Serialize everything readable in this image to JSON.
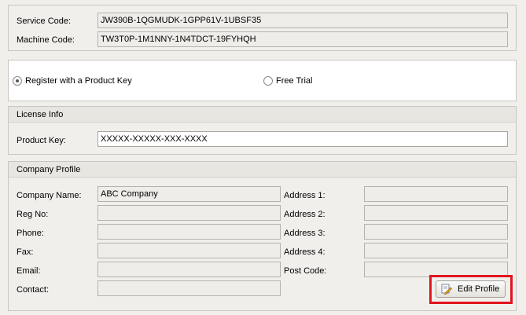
{
  "codes": {
    "service_label": "Service Code:",
    "service_value": "JW390B-1QGMUDK-1GPP61V-1UBSF35",
    "machine_label": "Machine Code:",
    "machine_value": "TW3T0P-1M1NNY-1N4TDCT-19FYHQH"
  },
  "registration": {
    "option_product_key": "Register with a Product Key",
    "option_free_trial": "Free Trial",
    "selected": "product_key"
  },
  "license": {
    "title": "License Info",
    "product_key_label": "Product Key:",
    "product_key_value": "XXXXX-XXXXX-XXX-XXXX"
  },
  "company": {
    "title": "Company Profile",
    "name_label": "Company Name:",
    "name_value": "ABC Company",
    "reg_label": "Reg No:",
    "phone_label": "Phone:",
    "fax_label": "Fax:",
    "email_label": "Email:",
    "contact_label": "Contact:",
    "address1_label": "Address 1:",
    "address2_label": "Address 2:",
    "address3_label": "Address 3:",
    "address4_label": "Address 4:",
    "postcode_label": "Post Code:",
    "edit_button": "Edit Profile",
    "edit_icon": "edit-profile-icon"
  },
  "colors": {
    "highlight": "#e2151d",
    "background": "#f0efec"
  }
}
